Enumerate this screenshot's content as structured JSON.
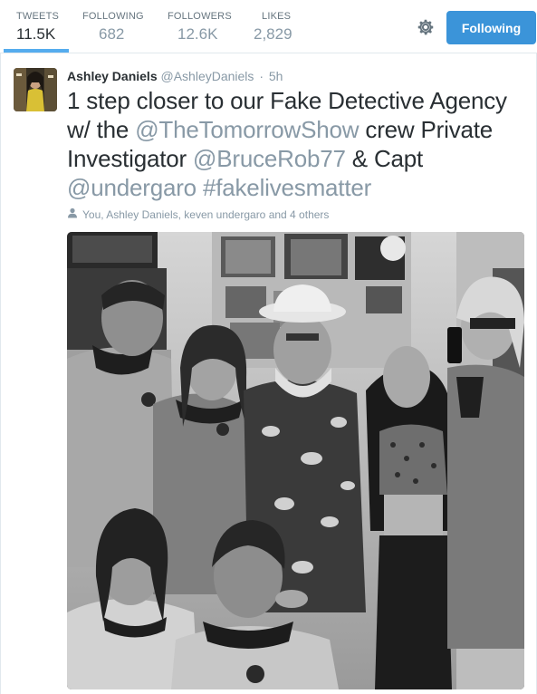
{
  "stats": [
    {
      "label": "TWEETS",
      "value": "11.5K"
    },
    {
      "label": "FOLLOWING",
      "value": "682"
    },
    {
      "label": "FOLLOWERS",
      "value": "12.6K"
    },
    {
      "label": "LIKES",
      "value": "2,829"
    }
  ],
  "actions": {
    "settings_icon": "gear-icon",
    "follow_button": "Following"
  },
  "tweet": {
    "fullname": "Ashley Daniels",
    "username": "@AshleyDaniels",
    "separator": "·",
    "time": "5h",
    "text": {
      "part1": "1 step closer to our Fake Detective Agency w/ the ",
      "mention1": "@TheTomorrowShow",
      "part2": " crew Private Investigator ",
      "mention2": "@BruceRob77",
      "part3": " & Capt ",
      "mention3": "@undergaro",
      "part4": " ",
      "hashtag": "#fakelivesmatter"
    },
    "context": {
      "icon": "person-icon",
      "text": "You, Ashley Daniels, keven undergaro and 4 others"
    }
  },
  "colors": {
    "accent": "#55acee",
    "button": "#3b94d9",
    "link": "#8899a6",
    "text": "#292f33"
  }
}
